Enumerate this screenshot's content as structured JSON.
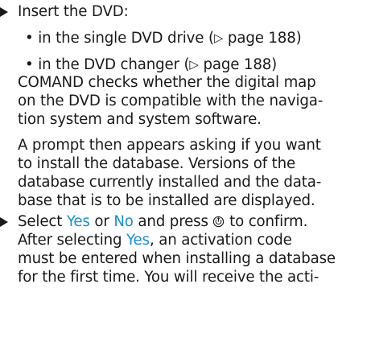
{
  "step1": {
    "bullet": "▶",
    "text": "Insert the DVD:"
  },
  "substeps": [
    {
      "bullet": "•",
      "text": "in the single DVD drive (",
      "ref_icon": "▷",
      "ref": " page 188)"
    },
    {
      "bullet": "•",
      "text": "in the DVD changer (",
      "ref_icon": "▷",
      "ref": " page 188)"
    }
  ],
  "para1": [
    "COMAND checks whether the digital map",
    "on the DVD is compatible with the naviga-",
    "tion system and system software."
  ],
  "para2": [
    "A prompt then appears asking if you want",
    "to install the database. Versions of the",
    "database currently installed and the data-",
    "base that is to be installed are displayed."
  ],
  "step2": {
    "bullet": "▶",
    "prefix": "Select ",
    "yes": "Yes",
    "or": " or ",
    "no": "No",
    "suffix": " and press ",
    "confirm": " to confirm."
  },
  "step2_cont": {
    "prefix": "After selecting ",
    "yes": "Yes",
    "suffix": ", an activation code"
  },
  "para3": [
    "must be entered when installing a database",
    "for the first time. You will receive the acti-"
  ],
  "colors": {
    "text": "#1a1a1a",
    "selection": "#1a8fd0"
  },
  "icons": {
    "bullet": "triangle-bullet-icon",
    "reference": "page-reference-icon",
    "controller": "controller-knob-icon"
  }
}
